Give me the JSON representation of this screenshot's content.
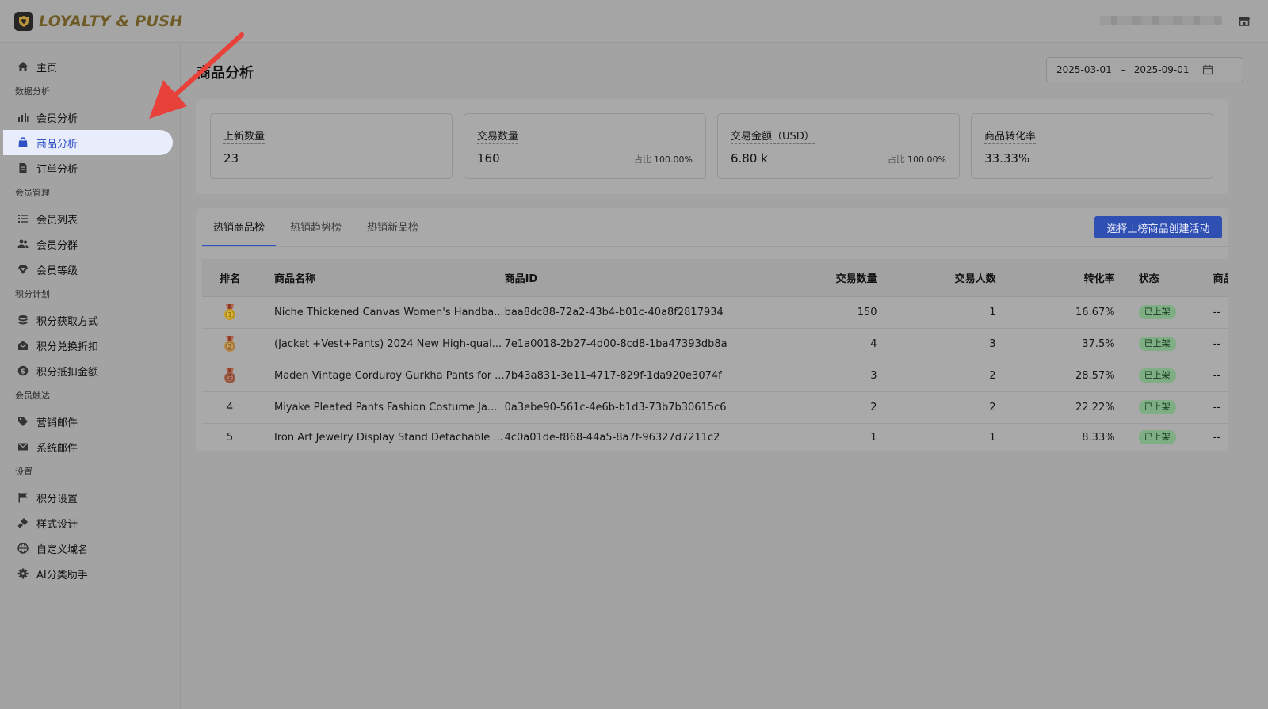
{
  "app": {
    "name": "LOYALTY & PUSH",
    "logo_icon": "heart-shield-icon"
  },
  "sidebar": {
    "sections": [
      {
        "items": [
          {
            "label": "主页",
            "icon": "home-icon"
          }
        ]
      },
      {
        "title": "数据分析",
        "items": [
          {
            "label": "会员分析",
            "icon": "bar-chart-icon"
          },
          {
            "label": "商品分析",
            "icon": "shopping-bag-icon",
            "active": true
          },
          {
            "label": "订单分析",
            "icon": "document-icon"
          }
        ]
      },
      {
        "title": "会员管理",
        "items": [
          {
            "label": "会员列表",
            "icon": "list-icon"
          },
          {
            "label": "会员分群",
            "icon": "users-icon"
          },
          {
            "label": "会员等级",
            "icon": "diamond-icon"
          }
        ]
      },
      {
        "title": "积分计划",
        "items": [
          {
            "label": "积分获取方式",
            "icon": "coins-icon"
          },
          {
            "label": "积分兑换折扣",
            "icon": "mail-open-icon"
          },
          {
            "label": "积分抵扣金额",
            "icon": "dollar-circle-icon"
          }
        ]
      },
      {
        "title": "会员触达",
        "items": [
          {
            "label": "营销邮件",
            "icon": "tag-icon"
          },
          {
            "label": "系统邮件",
            "icon": "envelope-icon"
          }
        ]
      },
      {
        "title": "设置",
        "items": [
          {
            "label": "积分设置",
            "icon": "flag-icon"
          },
          {
            "label": "样式设计",
            "icon": "brush-icon"
          },
          {
            "label": "自定义域名",
            "icon": "globe-icon"
          },
          {
            "label": "AI分类助手",
            "icon": "gear-icon"
          }
        ]
      }
    ]
  },
  "page": {
    "title": "商品分析",
    "date_start": "2025-03-01",
    "date_sep": "–",
    "date_end": "2025-09-01"
  },
  "stats": [
    {
      "label": "上新数量",
      "value": "23"
    },
    {
      "label": "交易数量",
      "value": "160",
      "share_label": "占比",
      "share": "100.00%"
    },
    {
      "label": "交易金额（USD）",
      "value": "6.80 k",
      "share_label": "占比",
      "share": "100.00%"
    },
    {
      "label": "商品转化率",
      "value": "33.33%"
    }
  ],
  "tabs": [
    {
      "label": "热销商品榜",
      "active": true
    },
    {
      "label": "热销趋势榜"
    },
    {
      "label": "热销新品榜"
    }
  ],
  "create_button": "选择上榜商品创建活动",
  "table": {
    "headers": {
      "rank": "排名",
      "name": "商品名称",
      "id": "商品ID",
      "qty": "交易数量",
      "people": "交易人数",
      "conv": "转化率",
      "status": "状态",
      "more": "商品"
    },
    "rows": [
      {
        "rank": "1",
        "medal": "gold",
        "name": "Niche Thickened Canvas Women's Handba...",
        "id": "baa8dc88-72a2-43b4-b01c-40a8f2817934",
        "qty": "150",
        "people": "1",
        "conv": "16.67%",
        "status": "已上架",
        "more": "--"
      },
      {
        "rank": "2",
        "medal": "bronze",
        "name": "(Jacket +Vest+Pants) 2024 New High-qual...",
        "id": "7e1a0018-2b27-4d00-8cd8-1ba47393db8a",
        "qty": "4",
        "people": "3",
        "conv": "37.5%",
        "status": "已上架",
        "more": "--"
      },
      {
        "rank": "3",
        "medal": "copper",
        "name": "Maden Vintage Corduroy Gurkha Pants for ...",
        "id": "7b43a831-3e11-4717-829f-1da920e3074f",
        "qty": "3",
        "people": "2",
        "conv": "28.57%",
        "status": "已上架",
        "more": "--"
      },
      {
        "rank": "4",
        "name": "Miyake Pleated Pants Fashion Costume Ja...",
        "id": "0a3ebe90-561c-4e6b-b1d3-73b7b30615c6",
        "qty": "2",
        "people": "2",
        "conv": "22.22%",
        "status": "已上架",
        "more": "--"
      },
      {
        "rank": "5",
        "name": "Iron Art Jewelry Display Stand Detachable ...",
        "id": "4c0a01de-f868-44a5-8a7f-96327d7211c2",
        "qty": "1",
        "people": "1",
        "conv": "8.33%",
        "status": "已上架",
        "more": "--"
      }
    ]
  },
  "colors": {
    "accent": "#2c4fc4",
    "brand": "#6e5a24",
    "annotation_arrow": "#e8413a",
    "status_badge": "#7fae85"
  }
}
